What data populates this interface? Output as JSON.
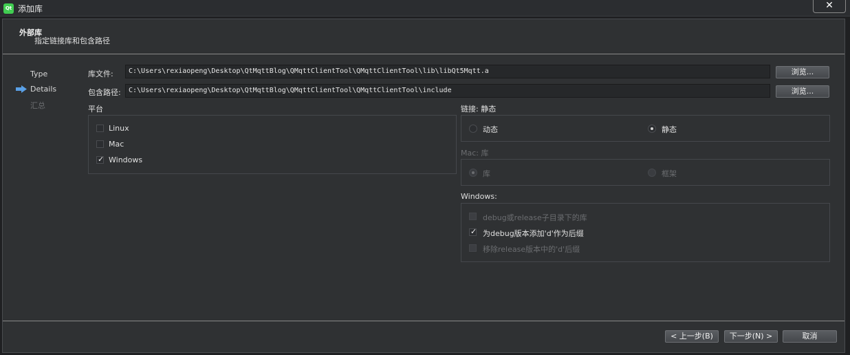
{
  "window": {
    "title": "添加库",
    "close_glyph": "✕",
    "icon_text": "Qt"
  },
  "header": {
    "title": "外部库",
    "subtitle": "指定链接库和包含路径"
  },
  "steps": [
    {
      "label": "Type"
    },
    {
      "label": "Details"
    },
    {
      "label": "汇总"
    }
  ],
  "fields": {
    "library_file_label": "库文件:",
    "library_file_value": "C:\\Users\\rexiaopeng\\Desktop\\QtMqttBlog\\QMqttClientTool\\QMqttClientTool\\lib\\libQt5Mqtt.a",
    "browse_label": "浏览...",
    "include_path_label": "包含路径:",
    "include_path_value": "C:\\Users\\rexiaopeng\\Desktop\\QtMqttBlog\\QMqttClientTool\\QMqttClientTool\\include"
  },
  "platform": {
    "title": "平台",
    "options": [
      {
        "label": "Linux",
        "checked": false
      },
      {
        "label": "Mac",
        "checked": false
      },
      {
        "label": "Windows",
        "checked": true
      }
    ]
  },
  "linking": {
    "title": "链接: 静态",
    "dynamic_label": "动态",
    "static_label": "静态",
    "selected": "static"
  },
  "mac": {
    "title": "Mac: 库",
    "library_label": "库",
    "framework_label": "框架",
    "selected": "library",
    "enabled": false
  },
  "windows": {
    "title": "Windows:",
    "options": [
      {
        "label": "debug或release子目录下的库",
        "checked": false,
        "enabled": false
      },
      {
        "label": "为debug版本添加'd'作为后缀",
        "checked": true,
        "enabled": true
      },
      {
        "label": "移除release版本中的'd'后缀",
        "checked": false,
        "enabled": false
      }
    ]
  },
  "footer": {
    "back_label": "< 上一步(B)",
    "next_label": "下一步(N) >",
    "cancel_label": "取消"
  },
  "colors": {
    "background": "#2f3133",
    "input_bg": "#26282a",
    "arrow_accent": "#5aa0e6",
    "qt_green": "#41cd52"
  }
}
